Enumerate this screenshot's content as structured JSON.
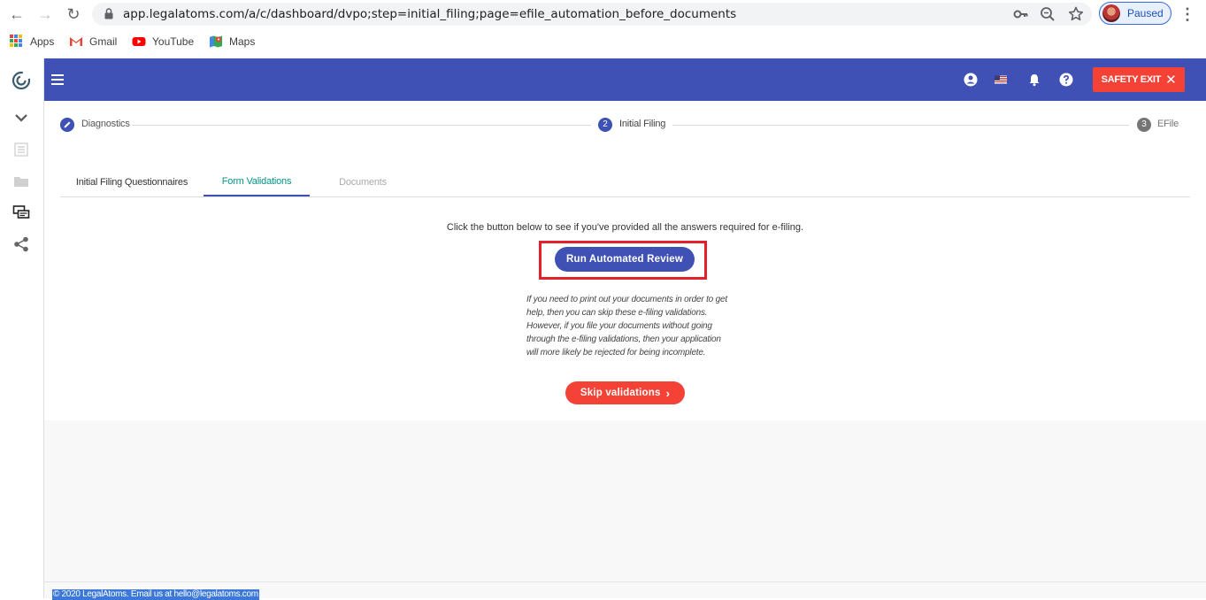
{
  "browser": {
    "url": "app.legalatoms.com/a/c/dashboard/dvpo;step=initial_filing;page=efile_automation_before_documents",
    "profile_label": "Paused",
    "bookmarks": [
      {
        "label": "Apps",
        "icon": "apps-grid-icon"
      },
      {
        "label": "Gmail",
        "icon": "gmail-icon"
      },
      {
        "label": "YouTube",
        "icon": "youtube-icon"
      },
      {
        "label": "Maps",
        "icon": "maps-icon"
      }
    ]
  },
  "sidebar": {
    "items": [
      "logo-icon",
      "chevron-down-icon",
      "list-icon",
      "folder-icon",
      "chat-icon",
      "share-icon"
    ]
  },
  "header": {
    "icons": [
      "account-icon",
      "us-flag-icon",
      "bell-icon",
      "help-icon"
    ],
    "safety_exit_label": "SAFETY EXIT",
    "colors": {
      "header": "#3f51b5",
      "danger": "#f44336"
    }
  },
  "stepper": {
    "steps": [
      {
        "number": "",
        "label": "Diagnostics",
        "state": "completed"
      },
      {
        "number": "2",
        "label": "Initial Filing",
        "state": "active"
      },
      {
        "number": "3",
        "label": "EFile",
        "state": "pending"
      }
    ]
  },
  "tabs": [
    {
      "label": "Initial Filing Questionnaires",
      "state": "normal"
    },
    {
      "label": "Form Validations",
      "state": "active"
    },
    {
      "label": "Documents",
      "state": "disabled"
    }
  ],
  "content": {
    "instructions": "Click the button below to see if you've provided all the answers required for e-filing.",
    "review_button": "Run Automated Review",
    "note": "If you need to print out your documents in order to get help, then you can skip these e-filing validations. However, if you file your documents without going through the e-filing validations, then your application will more likely be rejected for being incomplete.",
    "skip_button": "Skip validations"
  },
  "footer": {
    "text": "© 2020 LegalAtoms. Email us at hello@legalatoms.com"
  }
}
